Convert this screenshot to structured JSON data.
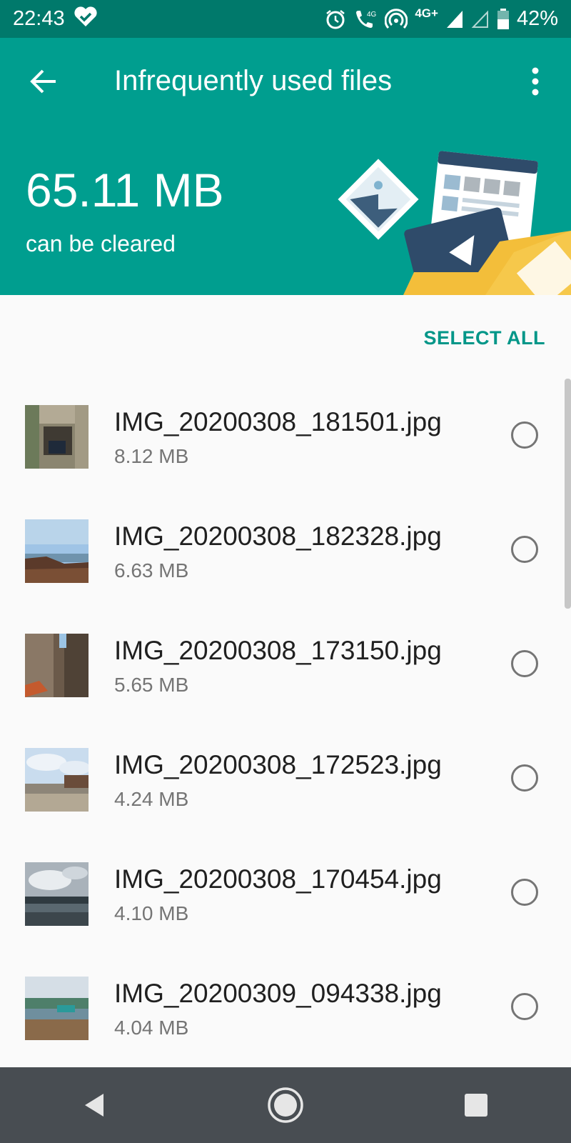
{
  "status_bar": {
    "time": "22:43",
    "network": "4G+",
    "battery": "42%",
    "icons": [
      "heart-check-icon",
      "alarm-icon",
      "volte-call-icon",
      "hotspot-icon",
      "signal-icon",
      "signal-empty-icon",
      "battery-icon"
    ]
  },
  "header": {
    "title": "Infrequently used files",
    "size": "65.11 MB",
    "caption": "can be cleared",
    "colors": {
      "status_bar": "#00796b",
      "header": "#009e8f"
    }
  },
  "actions": {
    "select_all": "SELECT ALL"
  },
  "files": [
    {
      "name": "IMG_20200308_181501.jpg",
      "size": "8.12 MB",
      "selected": false
    },
    {
      "name": "IMG_20200308_182328.jpg",
      "size": "6.63 MB",
      "selected": false
    },
    {
      "name": "IMG_20200308_173150.jpg",
      "size": "5.65 MB",
      "selected": false
    },
    {
      "name": "IMG_20200308_172523.jpg",
      "size": "4.24 MB",
      "selected": false
    },
    {
      "name": "IMG_20200308_170454.jpg",
      "size": "4.10 MB",
      "selected": false
    },
    {
      "name": "IMG_20200309_094338.jpg",
      "size": "4.04 MB",
      "selected": false
    }
  ],
  "nav": {
    "icons": [
      "back-triangle-icon",
      "home-circle-icon",
      "recents-square-icon"
    ]
  }
}
